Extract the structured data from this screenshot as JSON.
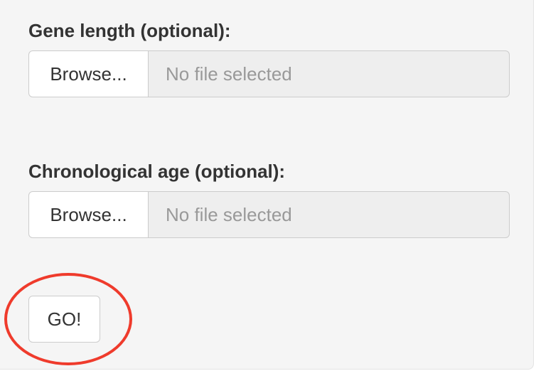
{
  "form": {
    "gene_length": {
      "label": "Gene length (optional):",
      "browse_label": "Browse...",
      "file_status": "No file selected"
    },
    "chronological_age": {
      "label": "Chronological age (optional):",
      "browse_label": "Browse...",
      "file_status": "No file selected"
    },
    "go_label": "GO!"
  },
  "colors": {
    "panel_background": "#f5f5f5",
    "highlight_annotation": "#ef3b2c"
  }
}
